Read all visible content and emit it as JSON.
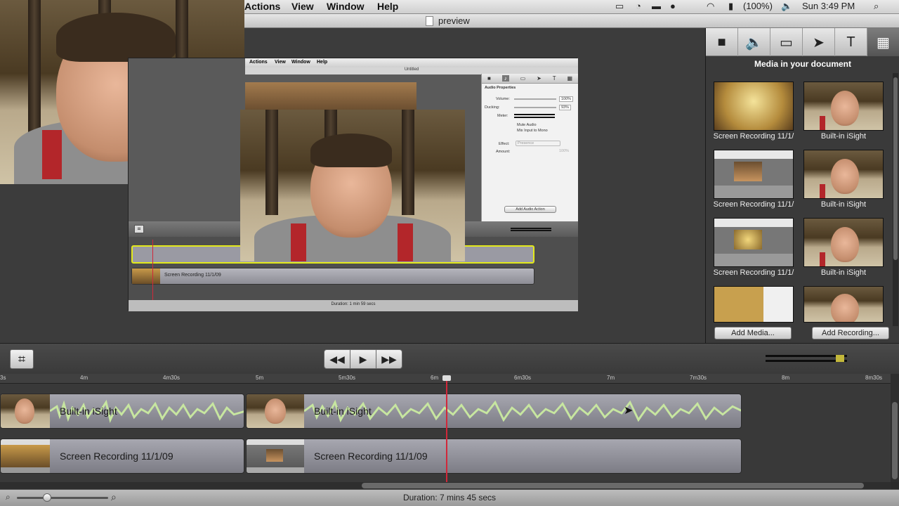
{
  "menubar": {
    "items": [
      "Actions",
      "View",
      "Window",
      "Help"
    ],
    "battery": "(100%)",
    "clock": "Sun 3:49 PM"
  },
  "window": {
    "title": "preview"
  },
  "inner": {
    "menu": [
      "Actions",
      "View",
      "Window",
      "Help"
    ],
    "title": "Untitled",
    "panel_title": "Audio Properties",
    "volume_label": "Volume:",
    "volume_value": "100%",
    "ducking_label": "Ducking:",
    "ducking_value": "93%",
    "meter_label": "Meter:",
    "mute_label": "Mute Audio",
    "mono_label": "Mix Input to Mono",
    "effect_label": "Effect:",
    "effect_value": "Presence",
    "amount_label": "Amount:",
    "amount_value": "100%",
    "add_action": "Add Audio Action",
    "clip_label": "Screen Recording 11/1/09",
    "duration": "Duration: 1 min 59 secs"
  },
  "media_panel": {
    "title": "Media in your document",
    "items": [
      {
        "label": "Screen Recording 11/1/"
      },
      {
        "label": "Built-in iSight"
      },
      {
        "label": "Screen Recording 11/1/"
      },
      {
        "label": "Built-in iSight"
      },
      {
        "label": "Screen Recording 11/1/"
      },
      {
        "label": "Built-in iSight"
      }
    ],
    "add_media": "Add Media...",
    "add_recording": "Add Recording..."
  },
  "ruler": {
    "ticks": [
      "3s",
      "4m",
      "4m30s",
      "5m",
      "5m30s",
      "6m",
      "6m30s",
      "7m",
      "7m30s",
      "8m",
      "8m30s"
    ]
  },
  "tracks": {
    "isight_label": "Built-in iSight",
    "screen_label": "Screen Recording 11/1/09"
  },
  "status": {
    "duration": "Duration: 7 mins 45 secs"
  }
}
